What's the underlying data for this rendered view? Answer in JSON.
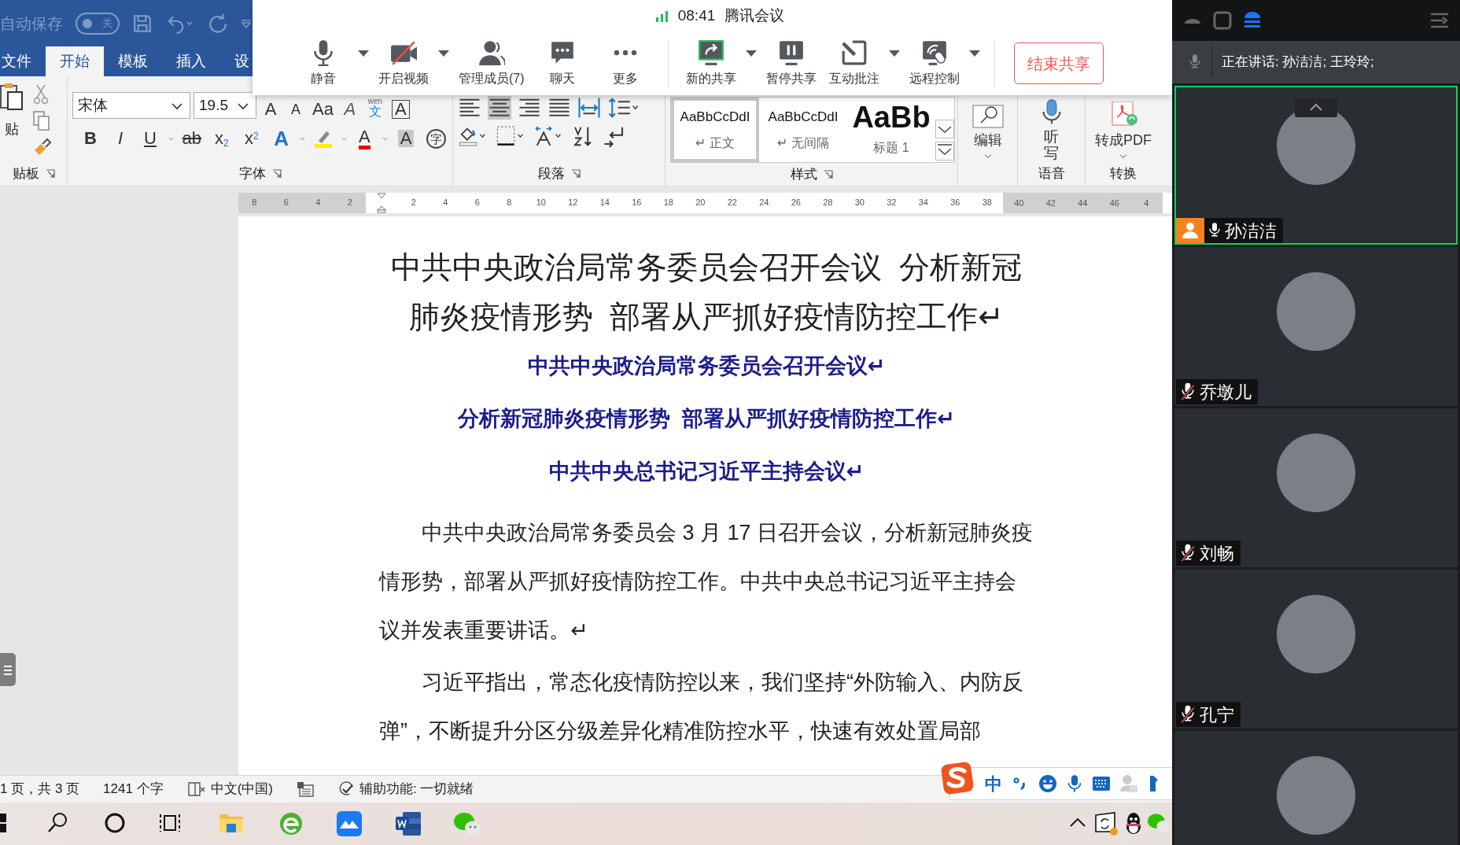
{
  "word": {
    "title_bar": {
      "autosave_label": "自动保存",
      "autosave_toggle": {
        "on": false,
        "label": "关"
      }
    },
    "tabs": [
      {
        "label": "文件",
        "selected": false
      },
      {
        "label": "开始",
        "selected": true
      },
      {
        "label": "模板",
        "selected": false
      },
      {
        "label": "插入",
        "selected": false
      },
      {
        "label": "设",
        "selected": false
      }
    ],
    "ribbon": {
      "clipboard": {
        "paste_label": "贴",
        "group_label": "贴板"
      },
      "font": {
        "font_name": "宋体",
        "font_size": "19.5",
        "group_label": "字体",
        "row1": [
          {
            "glyph": "A",
            "kind": "grow"
          },
          {
            "glyph": "A",
            "kind": "shrink"
          },
          {
            "glyph": "Aa",
            "kind": "case"
          },
          {
            "glyph": "A",
            "kind": "clear"
          },
          {
            "glyph": "文",
            "kind": "phonetic",
            "ruby": "wen"
          },
          {
            "glyph": "A",
            "kind": "border"
          }
        ],
        "row2": [
          {
            "glyph": "B",
            "kind": "bold"
          },
          {
            "glyph": "I",
            "kind": "italic"
          },
          {
            "glyph": "U",
            "kind": "underline",
            "dropdown": true
          },
          {
            "glyph": "ab",
            "kind": "strike"
          },
          {
            "glyph": "x$_{2}$",
            "kind": "sub"
          },
          {
            "glyph": "x$^{2}$",
            "kind": "sup"
          },
          {
            "glyph": "A",
            "kind": "effect",
            "dropdown": true
          },
          {
            "kind": "highlight",
            "dropdown": true
          },
          {
            "glyph": "A",
            "kind": "color",
            "dropdown": true
          },
          {
            "glyph": "A",
            "kind": "shade"
          },
          {
            "glyph": "字",
            "kind": "enclose"
          }
        ]
      },
      "paragraph": {
        "group_label": "段落"
      },
      "styles": {
        "group_label": "样式",
        "items": [
          {
            "preview": "AaBbCcDdI",
            "name": "↵ 正文",
            "kind": "body",
            "selected": true
          },
          {
            "preview": "AaBbCcDdI",
            "name": "↵ 无间隔",
            "kind": "body",
            "selected": false
          },
          {
            "preview": "AaBb",
            "name": "标题 1",
            "kind": "heading",
            "selected": false
          }
        ]
      },
      "editing": {
        "label": "编辑"
      },
      "voice": {
        "button_label": "听写",
        "group_label": "语音"
      },
      "convert": {
        "button_label": "转成PDF",
        "group_label": "转换"
      }
    },
    "ruler": {
      "left_ticks": [
        "8",
        "6",
        "4",
        "2"
      ],
      "right_ticks": [
        "2",
        "4",
        "6",
        "8",
        "10",
        "12",
        "14",
        "16",
        "18",
        "20",
        "22",
        "24",
        "26",
        "28",
        "30",
        "32",
        "34",
        "36",
        "38",
        "40",
        "42",
        "44",
        "46",
        "4"
      ]
    },
    "document": {
      "title": "中共中央政治局常务委员会召开会议  分析新冠肺炎疫情形势  部署从严抓好疫情防控工作↵",
      "subtitles": [
        "中共中央政治局常务委员会召开会议↵",
        "分析新冠肺炎疫情形势  部署从严抓好疫情防控工作↵",
        "中共中央总书记习近平主持会议↵"
      ],
      "paragraphs": [
        "中共中央政治局常务委员会 3 月 17 日召开会议，分析新冠肺炎疫情形势，部署从严抓好疫情防控工作。中共中央总书记习近平主持会议并发表重要讲话。↵",
        "习近平指出，常态化疫情防控以来，我们坚持“外防输入、内防反弹”，不断提升分区分级差异化精准防控水平，快速有效处置局部"
      ]
    },
    "status_bar": {
      "page": "1 页，共 3 页",
      "words": "1241 个字",
      "language": "中文(中国)",
      "accessibility": "辅助功能: 一切就绪"
    }
  },
  "ime_toolbar": {
    "mode": "中"
  },
  "meeting_toolbar": {
    "time": "08:41",
    "app_name": "腾讯会议",
    "buttons": [
      {
        "label": "静音",
        "kind": "mic",
        "dropdown": true,
        "separator_before": false
      },
      {
        "label": "开启视频",
        "kind": "video_off",
        "dropdown": true,
        "separator_before": false
      },
      {
        "label": "管理成员(7)",
        "kind": "members",
        "dropdown": false,
        "separator_before": false
      },
      {
        "label": "聊天",
        "kind": "chat",
        "dropdown": false,
        "separator_before": false
      },
      {
        "label": "更多",
        "kind": "more",
        "dropdown": false,
        "separator_before": false
      },
      {
        "label": "新的共享",
        "kind": "share",
        "dropdown": true,
        "separator_before": true
      },
      {
        "label": "暂停共享",
        "kind": "pause",
        "dropdown": false,
        "separator_before": false
      },
      {
        "label": "互动批注",
        "kind": "annotate",
        "dropdown": true,
        "separator_before": false
      },
      {
        "label": "远程控制",
        "kind": "remote",
        "dropdown": true,
        "separator_before": false
      }
    ],
    "end_button": "结束共享"
  },
  "participants_panel": {
    "speaking": "正在讲话: 孙洁洁; 王玲玲;",
    "tiles": [
      {
        "name": "孙洁洁",
        "selected": true,
        "muted": false,
        "host": true
      },
      {
        "name": "乔墩儿",
        "selected": false,
        "muted": true,
        "host": false
      },
      {
        "name": "刘畅",
        "selected": false,
        "muted": true,
        "host": false
      },
      {
        "name": "孔宁",
        "selected": false,
        "muted": true,
        "host": false
      },
      {
        "selected": false
      }
    ]
  }
}
